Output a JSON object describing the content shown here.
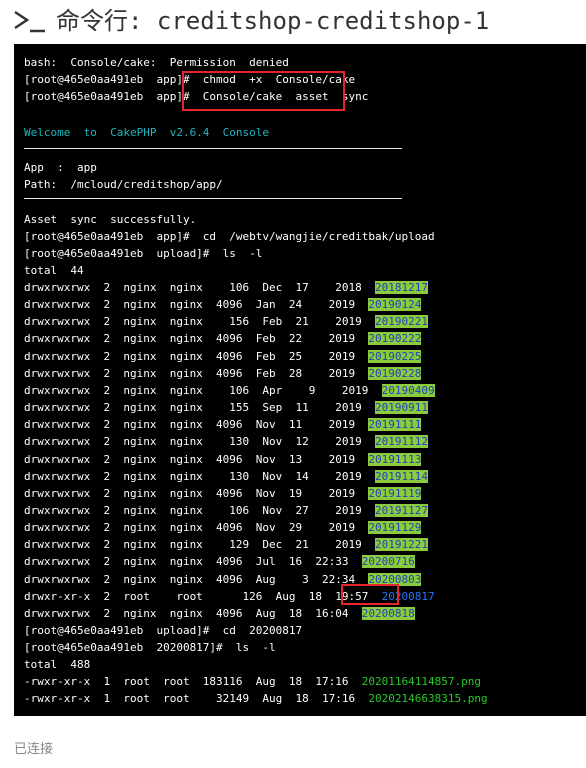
{
  "header": {
    "title": "命令行: creditshop-creditshop-1",
    "icon": "terminal-prompt-icon"
  },
  "terminal": {
    "lines": [
      "bash:  Console/cake:  Permission  denied",
      "[root@465e0aa491eb  app]#  chmod  +x  Console/cake",
      "[root@465e0aa491eb  app]#  Console/cake  asset  sync",
      "",
      "Welcome  to  CakePHP  v2.6.4  Console",
      "",
      "App  :  app",
      "Path:  /mcloud/creditshop/app/",
      "",
      "Asset  sync  successfully.",
      "[root@465e0aa491eb  app]#  cd  /webtv/wangjie/creditbak/upload",
      "[root@465e0aa491eb  upload]#  ls  -l",
      "total  44"
    ],
    "dir_entries": [
      {
        "text": "drwxrwxrwx  2  nginx  nginx    106  Dec  17    2018  ",
        "name": "20181217"
      },
      {
        "text": "drwxrwxrwx  2  nginx  nginx  4096  Jan  24    2019  ",
        "name": "20190124"
      },
      {
        "text": "drwxrwxrwx  2  nginx  nginx    156  Feb  21    2019  ",
        "name": "20190221"
      },
      {
        "text": "drwxrwxrwx  2  nginx  nginx  4096  Feb  22    2019  ",
        "name": "20190222"
      },
      {
        "text": "drwxrwxrwx  2  nginx  nginx  4096  Feb  25    2019  ",
        "name": "20190225"
      },
      {
        "text": "drwxrwxrwx  2  nginx  nginx  4096  Feb  28    2019  ",
        "name": "20190228"
      },
      {
        "text": "drwxrwxrwx  2  nginx  nginx    106  Apr    9    2019  ",
        "name": "20190409"
      },
      {
        "text": "drwxrwxrwx  2  nginx  nginx    155  Sep  11    2019  ",
        "name": "20190911"
      },
      {
        "text": "drwxrwxrwx  2  nginx  nginx  4096  Nov  11    2019  ",
        "name": "20191111"
      },
      {
        "text": "drwxrwxrwx  2  nginx  nginx    130  Nov  12    2019  ",
        "name": "20191112"
      },
      {
        "text": "drwxrwxrwx  2  nginx  nginx  4096  Nov  13    2019  ",
        "name": "20191113"
      },
      {
        "text": "drwxrwxrwx  2  nginx  nginx    130  Nov  14    2019  ",
        "name": "20191114"
      },
      {
        "text": "drwxrwxrwx  2  nginx  nginx  4096  Nov  19    2019  ",
        "name": "20191119"
      },
      {
        "text": "drwxrwxrwx  2  nginx  nginx    106  Nov  27    2019  ",
        "name": "20191127"
      },
      {
        "text": "drwxrwxrwx  2  nginx  nginx  4096  Nov  29    2019  ",
        "name": "20191129"
      },
      {
        "text": "drwxrwxrwx  2  nginx  nginx    129  Dec  21    2019  ",
        "name": "20191221"
      },
      {
        "text": "drwxrwxrwx  2  nginx  nginx  4096  Jul  16  22:33  ",
        "name": "20200716"
      },
      {
        "text": "drwxrwxrwx  2  nginx  nginx  4096  Aug    3  22:34  ",
        "name": "20200803"
      },
      {
        "text": "drwxr-xr-x  2  root    root      126  Aug  18  19:57  ",
        "name": "20200817"
      },
      {
        "text": "drwxrwxrwx  2  nginx  nginx  4096  Aug  18  16:04  ",
        "name": "20200818"
      }
    ],
    "after_lines": [
      "[root@465e0aa491eb  upload]#  cd  20200817",
      "[root@465e0aa491eb  20200817]#  ls  -l",
      "total  488"
    ],
    "files": [
      {
        "text": "-rwxr-xr-x  1  root  root  183116  Aug  18  17:16  ",
        "name": "20201164114857.png"
      },
      {
        "text": "-rwxr-xr-x  1  root  root    32149  Aug  18  17:16  ",
        "name": "20202146638315.png"
      }
    ]
  },
  "status": "已连接",
  "colors": {
    "terminal_bg": "#000000",
    "dir_highlight": "#8ccc3c",
    "annotation": "#e4262a",
    "welcome": "#1fb5bf"
  }
}
